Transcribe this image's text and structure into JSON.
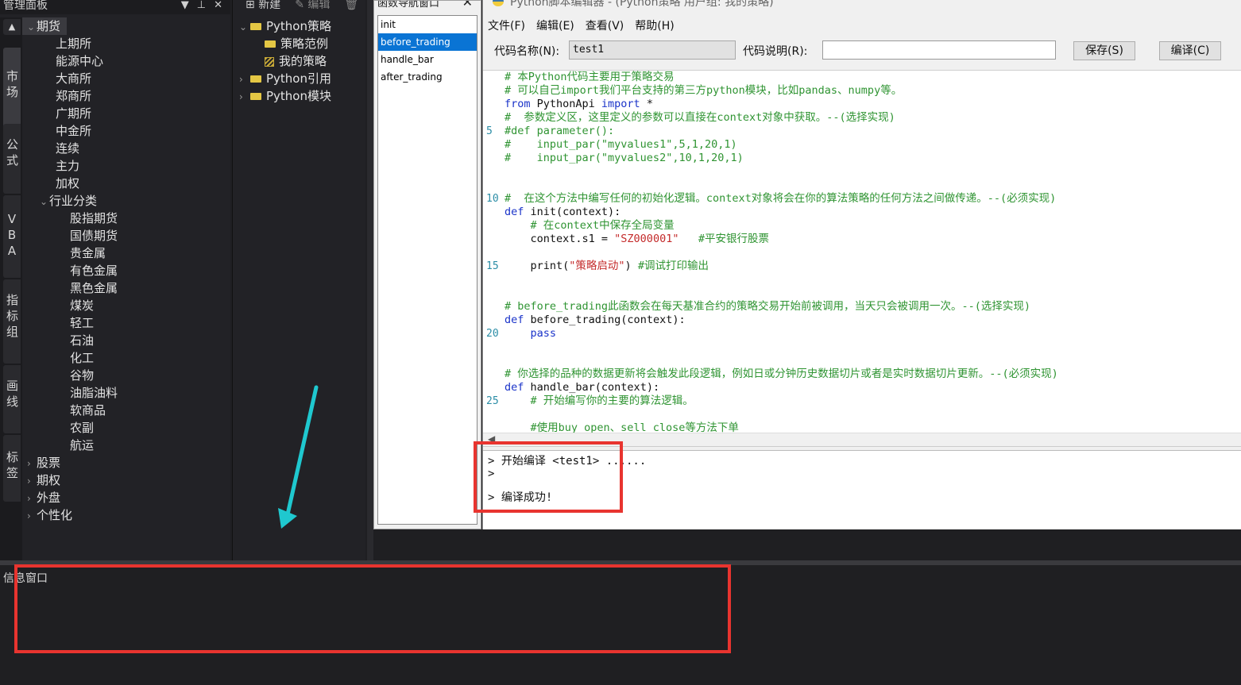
{
  "mgmt_panel": {
    "title": "管理面板",
    "controls": [
      "▼",
      "⊥",
      "✕"
    ],
    "side_tabs": [
      "市场",
      "公式",
      "VBA",
      "指标组",
      "画线",
      "标签"
    ],
    "tree": [
      {
        "label": "期货",
        "level": 0,
        "caret": "⌄"
      },
      {
        "label": "上期所",
        "level": 1
      },
      {
        "label": "能源中心",
        "level": 1
      },
      {
        "label": "大商所",
        "level": 1
      },
      {
        "label": "郑商所",
        "level": 1
      },
      {
        "label": "广期所",
        "level": 1
      },
      {
        "label": "中金所",
        "level": 1
      },
      {
        "label": "连续",
        "level": 1
      },
      {
        "label": "主力",
        "level": 1
      },
      {
        "label": "加权",
        "level": 1
      },
      {
        "label": "行业分类",
        "level": 1,
        "caret": "⌄"
      },
      {
        "label": "股指期货",
        "level": 2
      },
      {
        "label": "国债期货",
        "level": 2
      },
      {
        "label": "贵金属",
        "level": 2
      },
      {
        "label": "有色金属",
        "level": 2
      },
      {
        "label": "黑色金属",
        "level": 2
      },
      {
        "label": "煤炭",
        "level": 2
      },
      {
        "label": "轻工",
        "level": 2
      },
      {
        "label": "石油",
        "level": 2
      },
      {
        "label": "化工",
        "level": 2
      },
      {
        "label": "谷物",
        "level": 2
      },
      {
        "label": "油脂油料",
        "level": 2
      },
      {
        "label": "软商品",
        "level": 2
      },
      {
        "label": "农副",
        "level": 2
      },
      {
        "label": "航运",
        "level": 2
      },
      {
        "label": "股票",
        "level": 0,
        "caret": "›"
      },
      {
        "label": "期权",
        "level": 0,
        "caret": "›"
      },
      {
        "label": "外盘",
        "level": 0,
        "caret": "›"
      },
      {
        "label": "个性化",
        "level": 0,
        "caret": "›"
      }
    ]
  },
  "strategy_panel": {
    "toolbar": {
      "new_label": "新建",
      "edit_label": "编辑"
    },
    "tree": [
      {
        "label": "Python策略",
        "level": 0,
        "caret": "⌄",
        "icon": "folder-icon"
      },
      {
        "label": "策略范例",
        "level": 1,
        "icon": "folder-icon"
      },
      {
        "label": "我的策略",
        "level": 1,
        "icon": "document-icon"
      },
      {
        "label": "Python引用",
        "level": 0,
        "caret": "›",
        "icon": "folder-icon"
      },
      {
        "label": "Python模块",
        "level": 0,
        "caret": "›",
        "icon": "folder-icon"
      }
    ]
  },
  "function_navigator": {
    "title": "函数导航窗口",
    "items": [
      "init",
      "before_trading",
      "handle_bar",
      "after_trading"
    ],
    "selected": "before_trading"
  },
  "editor": {
    "title": "Python脚本编辑器 - (Python策略 用户组: 我的策略)",
    "menu": [
      "文件(F)",
      "编辑(E)",
      "查看(V)",
      "帮助(H)"
    ],
    "code_name_label": "代码名称(N):",
    "code_name_value": "test1",
    "code_desc_label": "代码说明(R):",
    "code_desc_value": "",
    "save_label": "保存(S)",
    "compile_label": "编译(C)",
    "code_lines": [
      {
        "n": "",
        "parts": [
          [
            "cmt",
            "# 本Python代码主要用于策略交易"
          ]
        ]
      },
      {
        "n": "",
        "parts": [
          [
            "cmt",
            "# 可以自己import我们平台支持的第三方python模块，比如pandas、numpy等。"
          ]
        ]
      },
      {
        "n": "",
        "parts": [
          [
            "kw",
            "from"
          ],
          [
            "blk",
            " PythonApi "
          ],
          [
            "kw",
            "import"
          ],
          [
            "blk",
            " *"
          ]
        ]
      },
      {
        "n": "",
        "parts": [
          [
            "cmt",
            "#  参数定义区，这里定义的参数可以直接在context对象中获取。--(选择实现)"
          ]
        ]
      },
      {
        "n": "5",
        "parts": [
          [
            "cmt",
            "#def parameter():"
          ]
        ]
      },
      {
        "n": "",
        "parts": [
          [
            "cmt",
            "#    input_par(\"myvalues1\",5,1,20,1)"
          ]
        ]
      },
      {
        "n": "",
        "parts": [
          [
            "cmt",
            "#    input_par(\"myvalues2\",10,1,20,1)"
          ]
        ]
      },
      {
        "n": "",
        "parts": []
      },
      {
        "n": "",
        "parts": []
      },
      {
        "n": "10",
        "parts": [
          [
            "cmt",
            "#  在这个方法中编写任何的初始化逻辑。context对象将会在你的算法策略的任何方法之间做传递。--(必须实现)"
          ]
        ]
      },
      {
        "n": "",
        "parts": [
          [
            "kw",
            "def"
          ],
          [
            "blk",
            " init(context):"
          ]
        ]
      },
      {
        "n": "",
        "parts": [
          [
            "cmt",
            "    # 在context中保存全局变量"
          ]
        ]
      },
      {
        "n": "",
        "parts": [
          [
            "blk",
            "    context.s1 = "
          ],
          [
            "str",
            "\"SZ000001\""
          ],
          [
            "blk",
            "   "
          ],
          [
            "cmt",
            "#平安银行股票"
          ]
        ]
      },
      {
        "n": "",
        "parts": []
      },
      {
        "n": "15",
        "parts": [
          [
            "blk",
            "    print("
          ],
          [
            "str",
            "\"策略启动\""
          ],
          [
            "blk",
            ") "
          ],
          [
            "cmt",
            "#调试打印输出"
          ]
        ]
      },
      {
        "n": "",
        "parts": []
      },
      {
        "n": "",
        "parts": []
      },
      {
        "n": "",
        "parts": [
          [
            "cmt",
            "# before_trading此函数会在每天基准合约的策略交易开始前被调用，当天只会被调用一次。--(选择实现)"
          ]
        ]
      },
      {
        "n": "",
        "parts": [
          [
            "kw",
            "def"
          ],
          [
            "blk",
            " before_trading(context):"
          ]
        ]
      },
      {
        "n": "20",
        "parts": [
          [
            "kw",
            "    pass"
          ]
        ]
      },
      {
        "n": "",
        "parts": []
      },
      {
        "n": "",
        "parts": []
      },
      {
        "n": "",
        "parts": [
          [
            "cmt",
            "# 你选择的品种的数据更新将会触发此段逻辑，例如日或分钟历史数据切片或者是实时数据切片更新。--(必须实现)"
          ]
        ]
      },
      {
        "n": "",
        "parts": [
          [
            "kw",
            "def"
          ],
          [
            "blk",
            " handle_bar(context):"
          ]
        ]
      },
      {
        "n": "25",
        "parts": [
          [
            "cmt",
            "    # 开始编写你的主要的算法逻辑。"
          ]
        ]
      },
      {
        "n": "",
        "parts": []
      },
      {
        "n": "",
        "parts": [
          [
            "cmt",
            "    #使用buy_open、sell_close等方法下单"
          ]
        ]
      }
    ],
    "output_lines": [
      "> 开始编译 <test1> ......",
      ">",
      "",
      "> 编译成功!"
    ]
  },
  "info_window": {
    "title": "信息窗口"
  },
  "colors": {
    "annotation_red": "#e8342f",
    "annotation_arrow": "#1fc8cf",
    "selection_blue": "#0a74d4"
  }
}
